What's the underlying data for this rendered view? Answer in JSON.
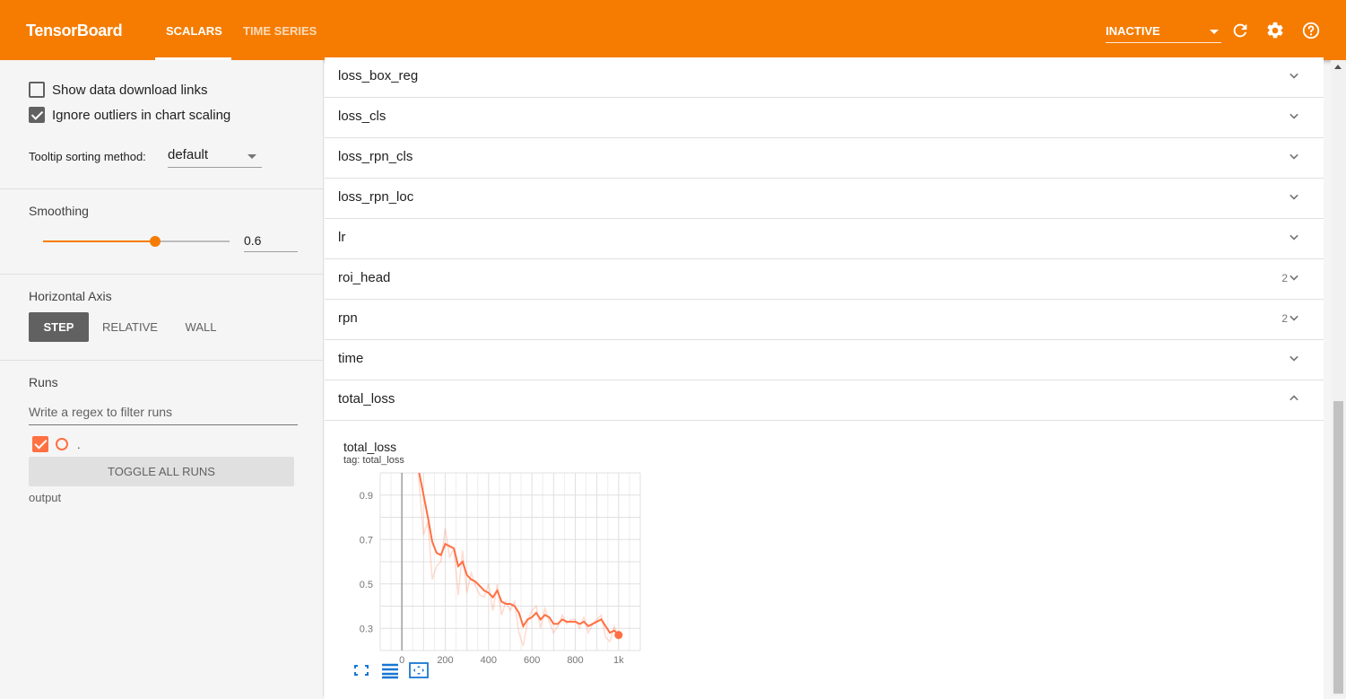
{
  "app": {
    "brand": "TensorBoard"
  },
  "header": {
    "tabs": [
      {
        "label": "SCALARS",
        "active": true
      },
      {
        "label": "TIME SERIES",
        "active": false
      }
    ],
    "status_value": "INACTIVE",
    "icons": [
      "refresh-icon",
      "settings-gear-icon",
      "help-icon"
    ],
    "accent_color": "#f57c00"
  },
  "sidebar": {
    "show_download_links": {
      "label": "Show data download links",
      "checked": false
    },
    "ignore_outliers": {
      "label": "Ignore outliers in chart scaling",
      "checked": true
    },
    "tooltip_sorting": {
      "label": "Tooltip sorting method:",
      "value": "default"
    },
    "smoothing": {
      "title": "Smoothing",
      "value": "0.6",
      "fraction": 0.6
    },
    "horizontal_axis": {
      "title": "Horizontal Axis",
      "options": [
        "STEP",
        "RELATIVE",
        "WALL"
      ],
      "selected": "STEP"
    },
    "runs": {
      "title": "Runs",
      "filter_placeholder": "Write a regex to filter runs",
      "items": [
        {
          "name": ".",
          "checked": true,
          "color": "#ff7043"
        }
      ],
      "toggle_label": "TOGGLE ALL RUNS",
      "output_label": "output"
    }
  },
  "main": {
    "categories": [
      {
        "name": "loss_box_reg",
        "count": "",
        "expanded": false
      },
      {
        "name": "loss_cls",
        "count": "",
        "expanded": false
      },
      {
        "name": "loss_rpn_cls",
        "count": "",
        "expanded": false
      },
      {
        "name": "loss_rpn_loc",
        "count": "",
        "expanded": false
      },
      {
        "name": "lr",
        "count": "",
        "expanded": false
      },
      {
        "name": "roi_head",
        "count": "2",
        "expanded": false
      },
      {
        "name": "rpn",
        "count": "2",
        "expanded": false
      },
      {
        "name": "time",
        "count": "",
        "expanded": false
      },
      {
        "name": "total_loss",
        "count": "",
        "expanded": true
      }
    ],
    "chart_card": {
      "title": "total_loss",
      "tag": "tag: total_loss"
    },
    "chart_tools": [
      "fullscreen-icon",
      "data-table-icon",
      "fit-domain-icon"
    ]
  },
  "chart_data": {
    "type": "line",
    "title": "total_loss",
    "xlabel": "",
    "ylabel": "",
    "xlim": [
      -100,
      1100
    ],
    "ylim": [
      0.2,
      1.0
    ],
    "x_ticks": [
      "0",
      "200",
      "400",
      "600",
      "800",
      "1k"
    ],
    "x_tick_values": [
      0,
      200,
      400,
      600,
      800,
      1000
    ],
    "y_ticks": [
      "0.3",
      "0.5",
      "0.7",
      "0.9"
    ],
    "y_tick_values": [
      0.3,
      0.5,
      0.7,
      0.9
    ],
    "grid": true,
    "series": [
      {
        "color": "#ff7043",
        "x": [
          60,
          80,
          100,
          120,
          140,
          160,
          180,
          200,
          220,
          240,
          260,
          280,
          300,
          320,
          340,
          360,
          380,
          400,
          420,
          440,
          460,
          480,
          500,
          520,
          540,
          560,
          580,
          600,
          620,
          640,
          660,
          680,
          700,
          720,
          740,
          760,
          780,
          800,
          820,
          840,
          860,
          880,
          900,
          920,
          940,
          960,
          980,
          1000
        ],
        "smoothed": [
          1.2,
          1.0,
          0.9,
          0.8,
          0.69,
          0.64,
          0.63,
          0.68,
          0.67,
          0.66,
          0.58,
          0.6,
          0.54,
          0.52,
          0.51,
          0.49,
          0.47,
          0.46,
          0.44,
          0.47,
          0.42,
          0.41,
          0.41,
          0.4,
          0.37,
          0.31,
          0.34,
          0.35,
          0.37,
          0.34,
          0.36,
          0.35,
          0.32,
          0.32,
          0.34,
          0.33,
          0.33,
          0.33,
          0.32,
          0.33,
          0.31,
          0.32,
          0.33,
          0.34,
          0.31,
          0.28,
          0.29,
          0.27
        ],
        "raw": [
          1.3,
          0.95,
          0.72,
          0.78,
          0.52,
          0.58,
          0.6,
          0.75,
          0.62,
          0.66,
          0.45,
          0.65,
          0.46,
          0.55,
          0.49,
          0.45,
          0.44,
          0.5,
          0.38,
          0.5,
          0.36,
          0.42,
          0.38,
          0.42,
          0.28,
          0.22,
          0.33,
          0.38,
          0.4,
          0.3,
          0.39,
          0.33,
          0.28,
          0.31,
          0.36,
          0.32,
          0.34,
          0.34,
          0.3,
          0.35,
          0.28,
          0.32,
          0.34,
          0.36,
          0.26,
          0.24,
          0.31,
          0.25
        ]
      }
    ]
  }
}
